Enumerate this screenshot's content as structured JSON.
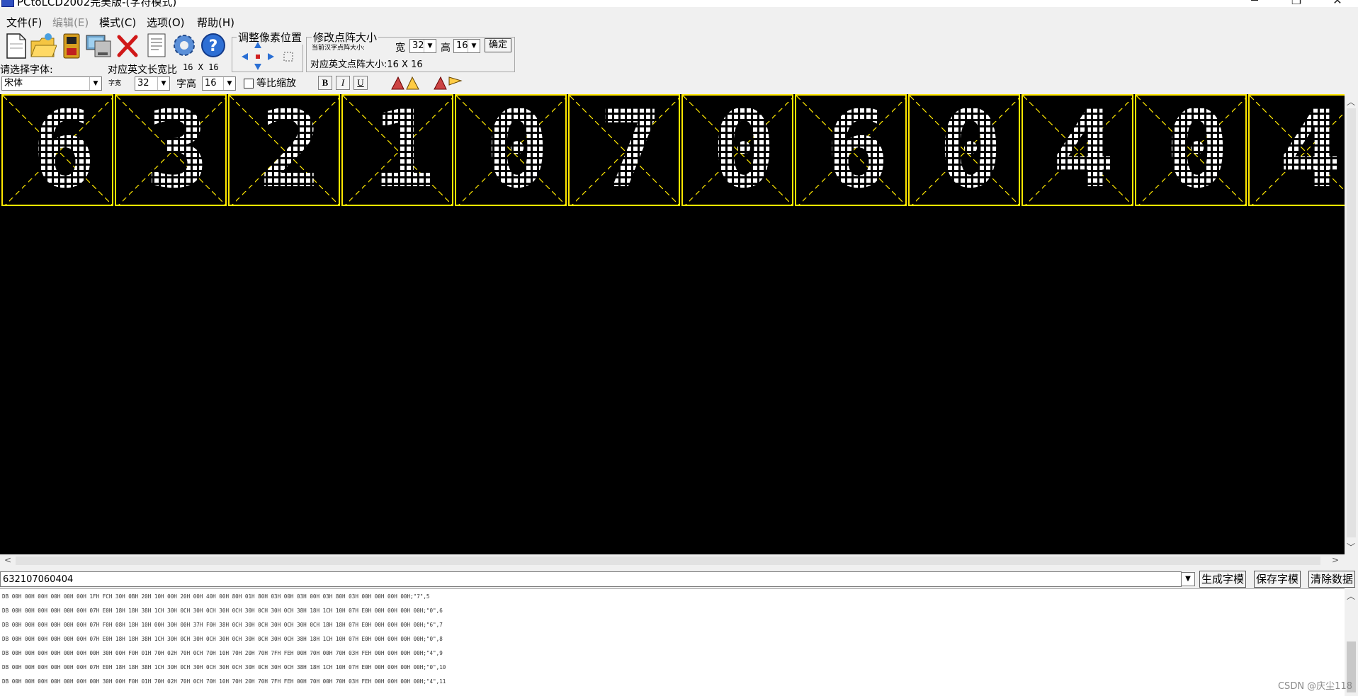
{
  "window": {
    "title": "PCtoLCD2002完美版-(字符模式)",
    "minimize": "─",
    "maximize": "❐",
    "close": "✕"
  },
  "menu": [
    {
      "label": "文件(F)",
      "enabled": true
    },
    {
      "label": "编辑(E)",
      "enabled": false
    },
    {
      "label": "模式(C)",
      "enabled": true
    },
    {
      "label": "选项(O)",
      "enabled": true
    },
    {
      "label": "帮助(H)",
      "enabled": true
    }
  ],
  "toolbar": {
    "icons": [
      "new-file-icon",
      "open-folder-icon",
      "save-disk-icon",
      "computer-icon",
      "delete-x-icon",
      "document-icon",
      "gear-icon",
      "help-icon"
    ],
    "adjust_group_title": "调整像素位置",
    "resize_group_title": "修改点阵大小",
    "current_dot_size_label": "当前汉字点阵大小:",
    "width_label": "宽",
    "width_value": "32",
    "height_label": "高",
    "height_value": "16",
    "confirm_label": "确定",
    "english_size_label": "对应英文点阵大小:16 X 16"
  },
  "font_row": {
    "select_font_label": "请选择字体:",
    "english_ratio_label": "对应英文长宽比",
    "english_ratio_value": "16 X 16",
    "font_value": "宋体",
    "char_width_label": "字宽",
    "char_width_value": "32",
    "char_height_label": "字高",
    "char_height_value": "16",
    "proportional_label": "等比缩放",
    "proportional_checked": false,
    "bold_label": "B",
    "italic_label": "I",
    "underline_label": "U"
  },
  "canvas": {
    "characters": [
      "6",
      "3",
      "2",
      "1",
      "0",
      "7",
      "0",
      "6",
      "0",
      "4",
      "0",
      "4"
    ],
    "background": "#000000",
    "grid_color": "#ffe800",
    "dot_color": "#ffffff"
  },
  "input": {
    "value": "632107060404",
    "generate_button": "生成字模",
    "save_button": "保存字模",
    "clear_button": "清除数据"
  },
  "output_lines": [
    "DB 00H 00H 00H 00H 00H 00H 1FH FCH 30H 0BH 20H 10H 00H 20H 00H 40H 00H 80H 01H 80H 03H 00H 03H 00H 03H 80H 03H 00H 00H 00H 00H;\"7\",5",
    "DB 00H 00H 00H 00H 00H 00H 07H E0H 18H 18H 38H 1CH 30H 0CH 30H 0CH 30H 0CH 30H 0CH 30H 0CH 38H 18H 1CH 10H 07H E0H 00H 00H 00H 00H;\"0\",6",
    "DB 00H 00H 00H 00H 00H 00H 07H F0H 08H 18H 10H 00H 30H 00H 37H F0H 38H 0CH 30H 0CH 30H 0CH 30H 0CH 18H 18H 07H E0H 00H 00H 00H 00H;\"6\",7",
    "DB 00H 00H 00H 00H 00H 00H 07H E0H 18H 18H 38H 1CH 30H 0CH 30H 0CH 30H 0CH 30H 0CH 30H 0CH 38H 18H 1CH 10H 07H E0H 00H 00H 00H 00H;\"0\",8",
    "DB 00H 00H 00H 00H 00H 00H 00H 30H 00H F0H 01H 70H 02H 70H 0CH 70H 10H 70H 20H 70H 7FH FEH 00H 70H 00H 70H 03H FEH 00H 00H 00H 00H;\"4\",9",
    "DB 00H 00H 00H 00H 00H 00H 07H E0H 18H 18H 38H 1CH 30H 0CH 30H 0CH 30H 0CH 30H 0CH 30H 0CH 38H 18H 1CH 10H 07H E0H 00H 00H 00H 00H;\"0\",10",
    "DB 00H 00H 00H 00H 00H 00H 00H 30H 00H F0H 01H 70H 02H 70H 0CH 70H 10H 70H 20H 70H 7FH FEH 00H 70H 00H 70H 03H FEH 00H 00H 00H 00H;\"4\",11"
  ],
  "watermark": "CSDN @庆尘118"
}
